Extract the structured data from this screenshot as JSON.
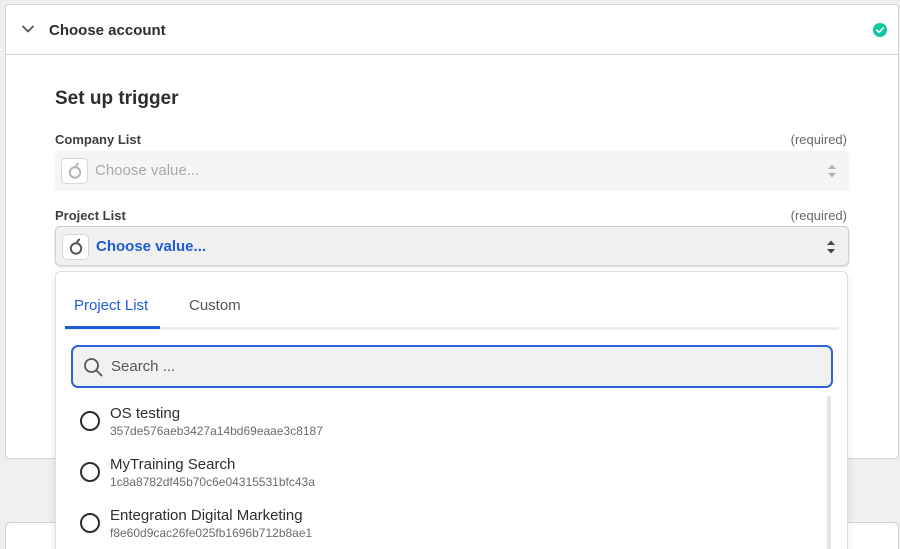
{
  "header": {
    "title": "Choose account"
  },
  "colors": {
    "accent": "#1e5bd6",
    "success": "#12c7a0"
  },
  "section": {
    "title": "Set up trigger"
  },
  "fields": {
    "company": {
      "label": "Company List",
      "required": "(required)",
      "value": "Choose value..."
    },
    "project": {
      "label": "Project List",
      "required": "(required)",
      "value": "Choose value..."
    }
  },
  "dropdown": {
    "tabs": [
      {
        "label": "Project List",
        "active": true
      },
      {
        "label": "Custom",
        "active": false
      }
    ],
    "search_placeholder": "Search ...",
    "items": [
      {
        "name": "OS testing",
        "id": "357de576aeb3427a14bd69eaae3c8187"
      },
      {
        "name": "MyTraining Search",
        "id": "1c8a8782df45b70c6e04315531bfc43a"
      },
      {
        "name": "Entegration Digital Marketing",
        "id": "f8e60d9cac26fe025fb1696b712b8ae1"
      }
    ]
  }
}
